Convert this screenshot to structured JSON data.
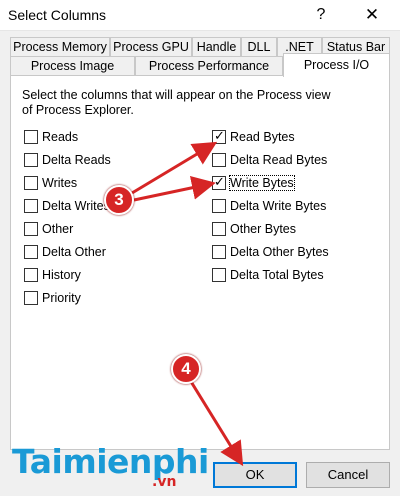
{
  "window": {
    "title": "Select Columns",
    "help_glyph": "?",
    "close_glyph": "✕"
  },
  "tabs": {
    "row_back": [
      "Process Memory",
      "Process GPU",
      "Handle",
      "DLL",
      ".NET",
      "Status Bar"
    ],
    "row_front": [
      "Process Image",
      "Process Performance",
      "Process I/O"
    ],
    "active": "Process I/O"
  },
  "panel": {
    "description": "Select the columns that will appear on the Process view of Process Explorer."
  },
  "left_checkboxes": [
    {
      "label": "Reads",
      "checked": false
    },
    {
      "label": "Delta Reads",
      "checked": false
    },
    {
      "label": "Writes",
      "checked": false
    },
    {
      "label": "Delta Writes",
      "checked": false
    },
    {
      "label": "Other",
      "checked": false
    },
    {
      "label": "Delta Other",
      "checked": false
    },
    {
      "label": "History",
      "checked": false
    },
    {
      "label": "Priority",
      "checked": false
    }
  ],
  "right_checkboxes": [
    {
      "label": "Read Bytes",
      "checked": true
    },
    {
      "label": "Delta Read Bytes",
      "checked": false
    },
    {
      "label": "Write Bytes",
      "checked": true
    },
    {
      "label": "Delta Write Bytes",
      "checked": false
    },
    {
      "label": "Other Bytes",
      "checked": false
    },
    {
      "label": "Delta Other Bytes",
      "checked": false
    },
    {
      "label": "Delta Total Bytes",
      "checked": false
    }
  ],
  "buttons": {
    "ok": "OK",
    "cancel": "Cancel"
  },
  "annotations": {
    "step3": "3",
    "step4": "4",
    "color": "#d62525"
  },
  "watermark": {
    "main": "Taimienphi",
    "sub": ".vn"
  },
  "icons": {
    "check": "✓"
  }
}
